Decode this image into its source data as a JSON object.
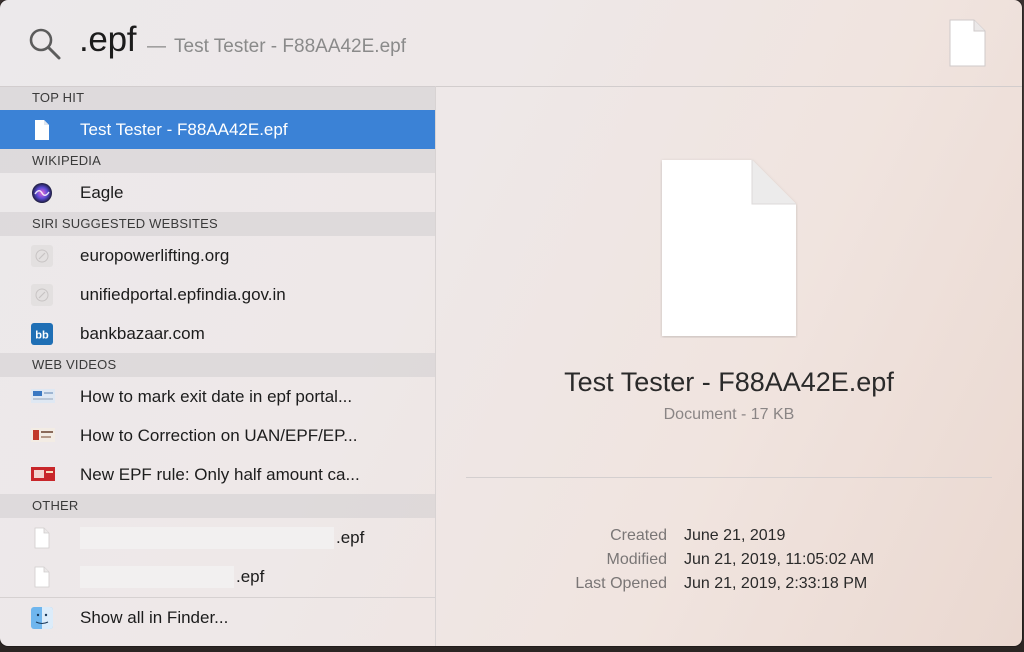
{
  "search": {
    "query": ".epf",
    "completion_dash": "—",
    "completion": "Test Tester - F88AA42E.epf"
  },
  "sections": {
    "top_hit": "TOP HIT",
    "wikipedia": "WIKIPEDIA",
    "siri": "SIRI SUGGESTED WEBSITES",
    "web_videos": "WEB VIDEOS",
    "other": "OTHER"
  },
  "results": {
    "top_hit": {
      "label": "Test Tester - F88AA42E.epf",
      "icon": "document-icon"
    },
    "wikipedia": {
      "label": "Eagle",
      "icon": "siri-icon"
    },
    "websites": [
      {
        "label": "europowerlifting.org",
        "icon": "safari-compass-icon"
      },
      {
        "label": "unifiedportal.epfindia.gov.in",
        "icon": "safari-compass-icon"
      },
      {
        "label": "bankbazaar.com",
        "icon": "bankbazaar-icon"
      }
    ],
    "videos": [
      {
        "label": "How to mark exit date in epf portal..."
      },
      {
        "label": "How to Correction on UAN/EPF/EP..."
      },
      {
        "label": "New EPF rule: Only half amount ca..."
      }
    ],
    "other": [
      {
        "suffix": ".epf"
      },
      {
        "suffix": ".epf"
      }
    ],
    "show_all": "Show all in Finder..."
  },
  "preview": {
    "title": "Test Tester - F88AA42E.epf",
    "subtitle": "Document - 17 KB",
    "meta": [
      {
        "key": "Created",
        "value": "June 21, 2019"
      },
      {
        "key": "Modified",
        "value": "Jun 21, 2019, 11:05:02 AM"
      },
      {
        "key": "Last Opened",
        "value": "Jun 21, 2019, 2:33:18 PM"
      }
    ]
  },
  "colors": {
    "selection": "#3b82d6",
    "section_header_bg": "#d2ced0"
  }
}
